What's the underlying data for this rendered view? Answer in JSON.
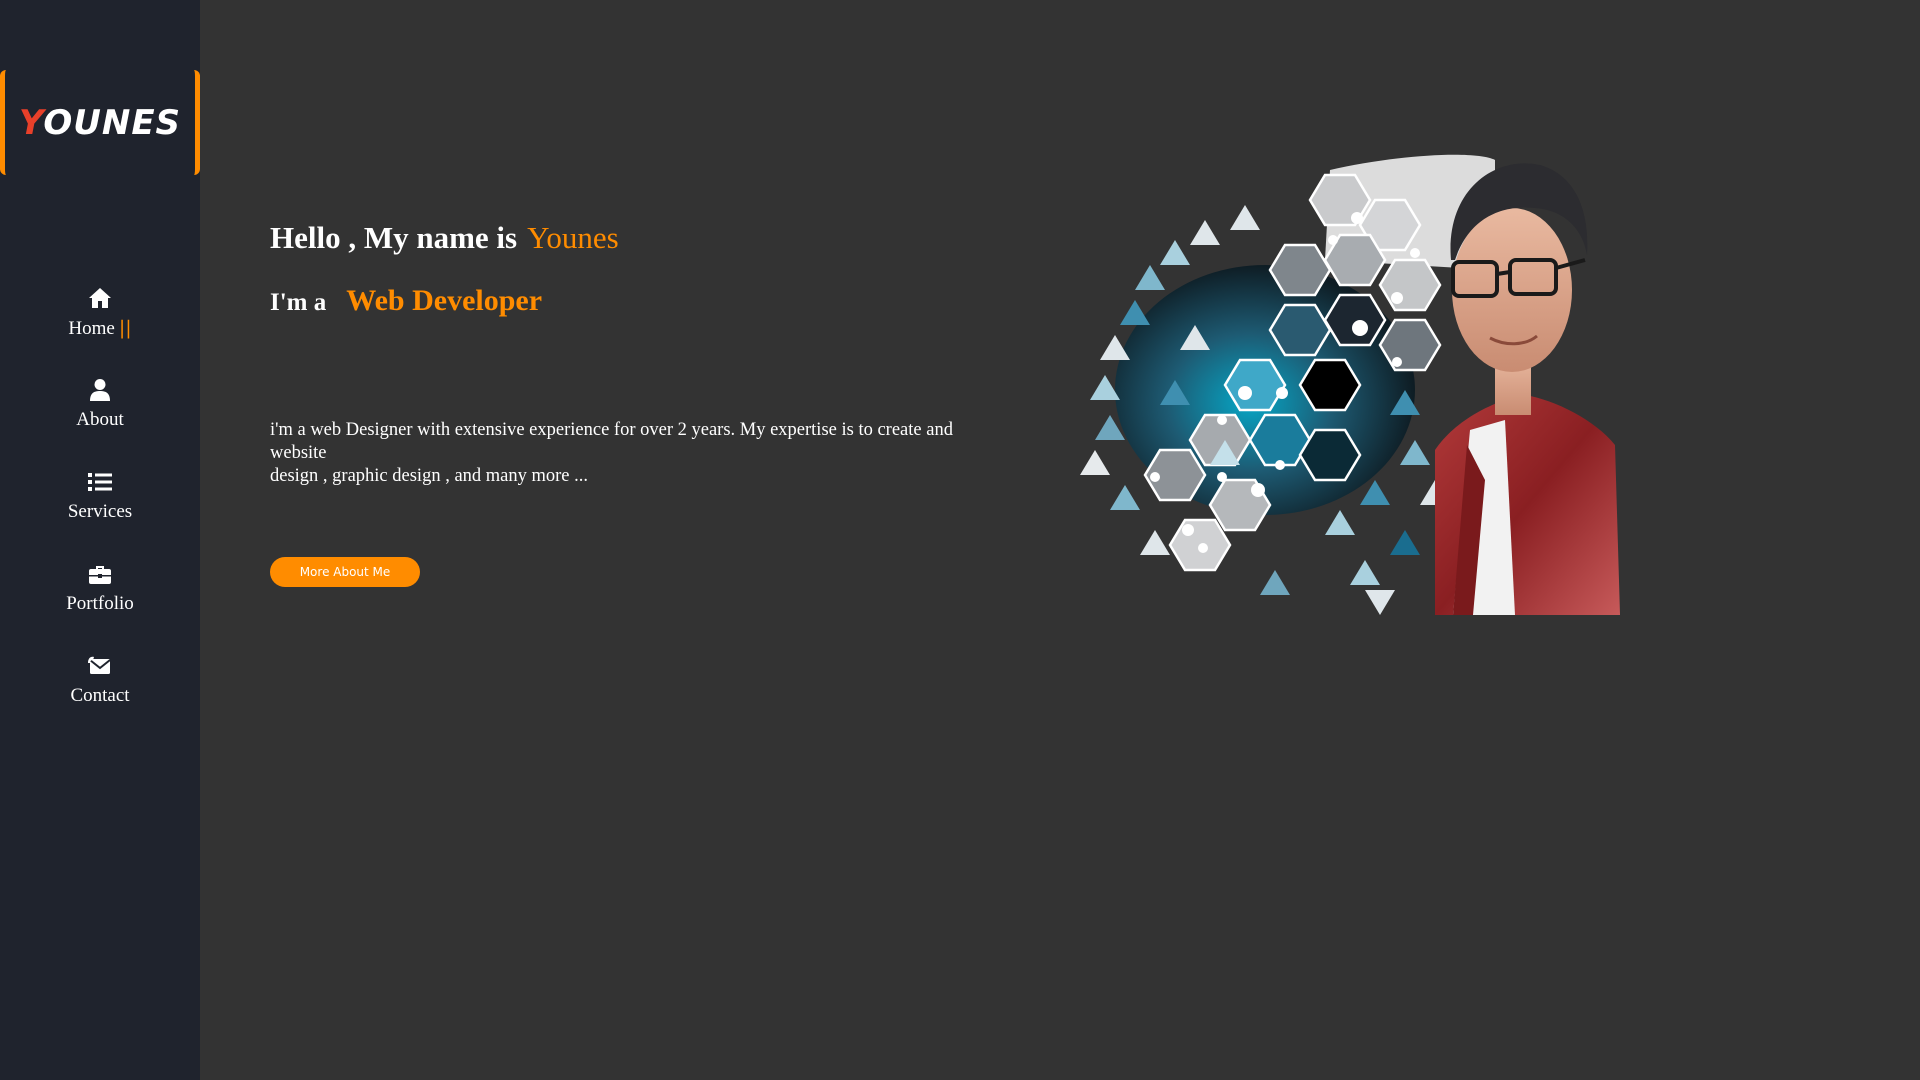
{
  "sidebar": {
    "logo": {
      "initial": "Y",
      "rest": "OUNES"
    },
    "nav": [
      {
        "label": "Home",
        "icon": "home-icon",
        "active": true
      },
      {
        "label": "About",
        "icon": "user-icon",
        "active": false
      },
      {
        "label": "Services",
        "icon": "list-icon",
        "active": false
      },
      {
        "label": "Portfolio",
        "icon": "briefcase-icon",
        "active": false
      },
      {
        "label": "Contact",
        "icon": "envelope-icon",
        "active": false
      }
    ],
    "active_marker": "||"
  },
  "hero": {
    "greeting": "Hello , My name is",
    "name": "Younes",
    "role_prefix": "I'm a",
    "role": "Web Developer",
    "bio_line1": "i'm a web Designer with extensive experience for over 2 years. My expertise is to create and website",
    "bio_line2": "design , graphic design , and many more ...",
    "cta_label": "More About Me"
  },
  "colors": {
    "accent": "#ff8c00",
    "logo_red": "#e8402a",
    "sidebar_bg": "#1f232d",
    "page_bg": "#333333"
  }
}
